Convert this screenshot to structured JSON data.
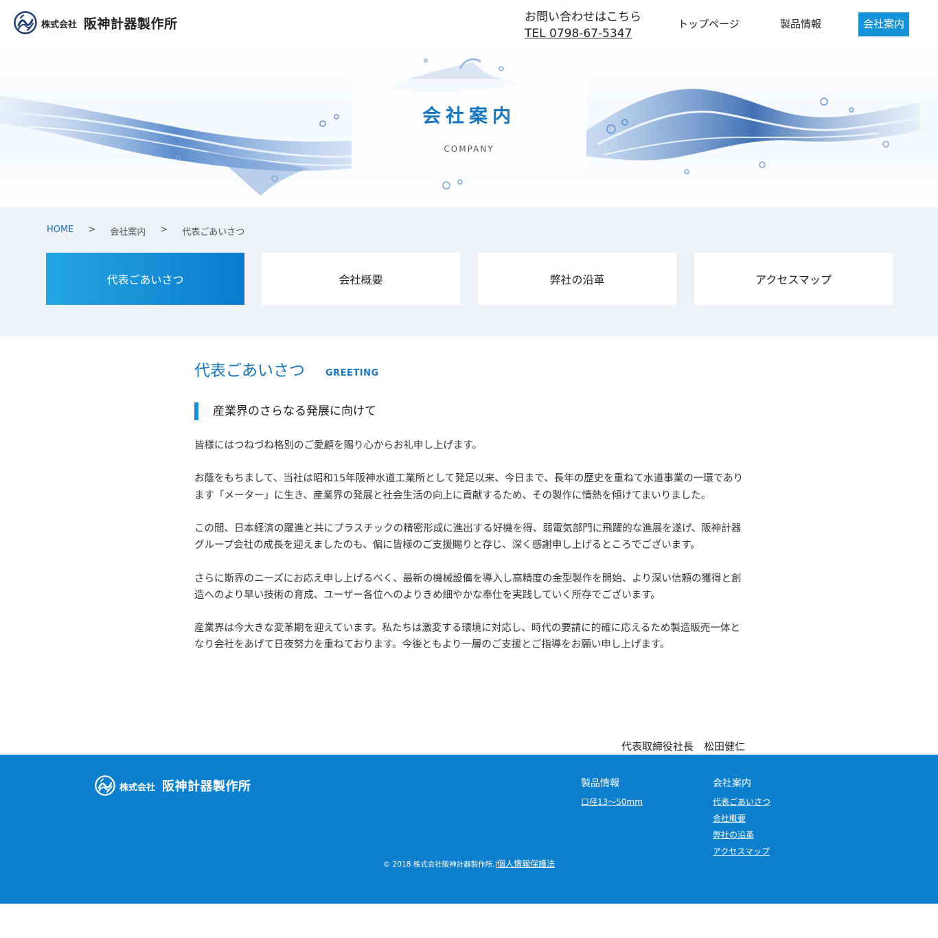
{
  "header": {
    "logo_small": "株式会社",
    "logo_name": "阪神計器製作所",
    "contact_label": "お問い合わせはこちら",
    "contact_tel": "TEL 0798-67-5347",
    "nav": [
      {
        "label": "トップページ"
      },
      {
        "label": "製品情報"
      },
      {
        "label": "会社案内"
      }
    ]
  },
  "hero": {
    "title": "会社案内",
    "subtitle": "COMPANY"
  },
  "breadcrumb": {
    "items": [
      "HOME",
      "会社案内",
      "代表ごあいさつ"
    ],
    "separator": ">"
  },
  "tabs": [
    {
      "label": "代表ごあいさつ"
    },
    {
      "label": "会社概要"
    },
    {
      "label": "弊社の沿革"
    },
    {
      "label": "アクセスマップ"
    }
  ],
  "section": {
    "title": "代表ごあいさつ",
    "title_en": "GREETING",
    "lead": "産業界のさらなる発展に向けて",
    "paragraphs": [
      "皆様にはつねづね格別のご愛顧を賜り心からお礼申し上げます。",
      "お蔭をもちまして、当社は昭和15年阪神水道工業所として発足以来、今日まで、長年の歴史を重ねて水道事業の一環であります「メーター」に生き、産業界の発展と社会生活の向上に貢献するため、その製作に情熱を傾けてまいりました。",
      "この間、日本経済の躍進と共にプラスチックの精密形成に進出する好機を得、弱電気部門に飛躍的な進展を遂げ、阪神計器グループ会社の成長を迎えましたのも、偏に皆様のご支援賜りと存じ、深く感謝申し上げるところでございます。",
      "さらに斯界のニーズにお応え申し上げるべく、最新の機械設備を導入し高精度の金型製作を開始、より深い信頼の獲得と創造へのより早い技術の育成、ユーザー各位へのよりきめ細やかな奉仕を実践していく所存でございます。",
      "産業界は今大きな変革期を迎えています。私たちは激変する環境に対応し、時代の要請に的確に応えるため製造販売一体となり会社をあげて日夜努力を重ねております。今後ともより一層のご支援とご指導をお願い申し上げます。"
    ],
    "signature": "代表取締役社長　松田健仁"
  },
  "footer": {
    "logo_small": "株式会社",
    "logo_name": "阪神計器製作所",
    "products": {
      "heading": "製品情報",
      "links": [
        "口径13～50mm"
      ]
    },
    "company": {
      "heading": "会社案内",
      "links": [
        "代表ごあいさつ",
        "会社概要",
        "弊社の沿革",
        "アクセスマップ"
      ]
    },
    "copyright": "© 2018 株式会社阪神計器製作所.",
    "privacy": "個人情報保護法"
  },
  "colors": {
    "accent": "#1592d8",
    "title_blue": "#1676c0",
    "footer_bg": "#0c80cf",
    "subnav_bg": "#eef2f7"
  }
}
